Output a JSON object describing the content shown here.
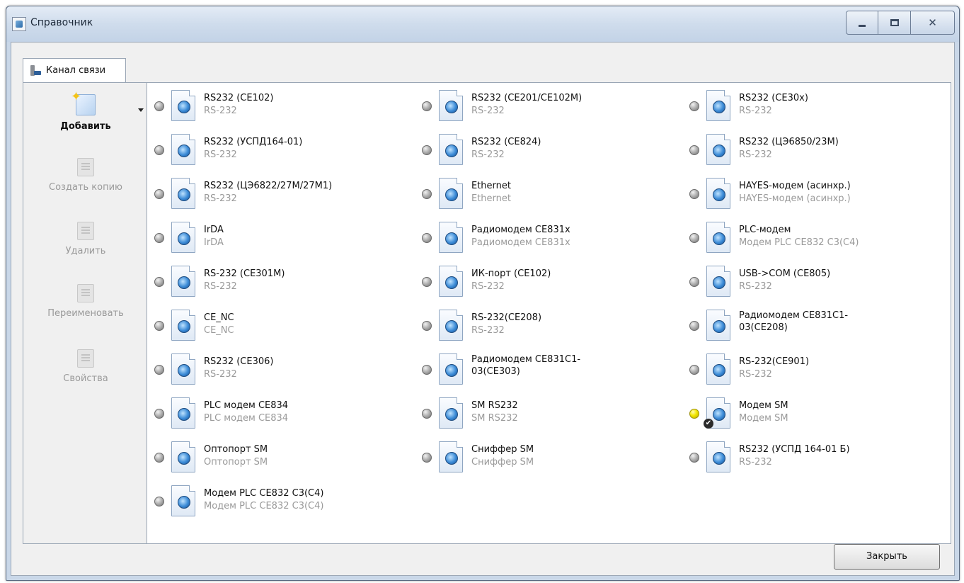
{
  "window": {
    "title": "Справочник",
    "controls": {
      "minimize": "–",
      "maximize": "",
      "close": "✕"
    }
  },
  "tabs": [
    {
      "label": "Канал связи",
      "icon": "channel-icon"
    }
  ],
  "sidebar": {
    "add": "Добавить",
    "copy": "Создать копию",
    "delete": "Удалить",
    "rename": "Переименовать",
    "properties": "Свойства"
  },
  "items": [
    {
      "name": "RS232 (CE102)",
      "type": "RS-232",
      "status": "grey"
    },
    {
      "name": "RS232 (CE201/CE102M)",
      "type": "RS-232",
      "status": "grey"
    },
    {
      "name": "RS232 (CE30x)",
      "type": "RS-232",
      "status": "grey"
    },
    {
      "name": "RS232 (УСПД164-01)",
      "type": "RS-232",
      "status": "grey"
    },
    {
      "name": "RS232 (CE824)",
      "type": "RS-232",
      "status": "grey"
    },
    {
      "name": "RS232 (ЦЭ6850/23М)",
      "type": "RS-232",
      "status": "grey"
    },
    {
      "name": "RS232 (ЦЭ6822/27М/27М1)",
      "type": "RS-232",
      "status": "grey"
    },
    {
      "name": "Ethernet",
      "type": "Ethernet",
      "status": "grey"
    },
    {
      "name": "HAYES-модем (асинхр.)",
      "type": "HAYES-модем (асинхр.)",
      "status": "grey"
    },
    {
      "name": "IrDA",
      "type": "IrDA",
      "status": "grey"
    },
    {
      "name": "Радиомодем CE831x",
      "type": "Радиомодем CE831x",
      "status": "grey"
    },
    {
      "name": "PLC-модем",
      "type": "Модем PLC CE832 C3(C4)",
      "status": "grey"
    },
    {
      "name": "RS-232 (CE301M)",
      "type": "RS-232",
      "status": "grey"
    },
    {
      "name": "ИК-порт (CE102)",
      "type": "RS-232",
      "status": "grey"
    },
    {
      "name": "USB->COM (CE805)",
      "type": "RS-232",
      "status": "grey"
    },
    {
      "name": "CE_NC",
      "type": "CE_NC",
      "status": "grey"
    },
    {
      "name": "RS-232(CE208)",
      "type": "RS-232",
      "status": "grey"
    },
    {
      "name": "Радиомодем CE831C1-03(CE208)",
      "type": "",
      "status": "grey"
    },
    {
      "name": "RS232 (CE306)",
      "type": "RS-232",
      "status": "grey"
    },
    {
      "name": "Радиомодем CE831C1-03(CE303)",
      "type": "",
      "status": "grey"
    },
    {
      "name": "RS-232(CE901)",
      "type": "RS-232",
      "status": "grey"
    },
    {
      "name": "PLC модем CE834",
      "type": "PLC модем CE834",
      "status": "grey"
    },
    {
      "name": "SM RS232",
      "type": "SM RS232",
      "status": "grey"
    },
    {
      "name": "Модем SM",
      "type": "Модем SM",
      "status": "active",
      "checked": true
    },
    {
      "name": "Оптопорт SM",
      "type": "Оптопорт SM",
      "status": "grey"
    },
    {
      "name": "Сниффер SM",
      "type": "Сниффер SM",
      "status": "grey"
    },
    {
      "name": "RS232 (УСПД 164-01 Б)",
      "type": "RS-232",
      "status": "grey"
    },
    {
      "name": "Модем PLC CE832 C3(C4)",
      "type": "Модем PLC CE832 C3(C4)",
      "status": "grey"
    }
  ],
  "footer": {
    "close": "Закрыть"
  }
}
